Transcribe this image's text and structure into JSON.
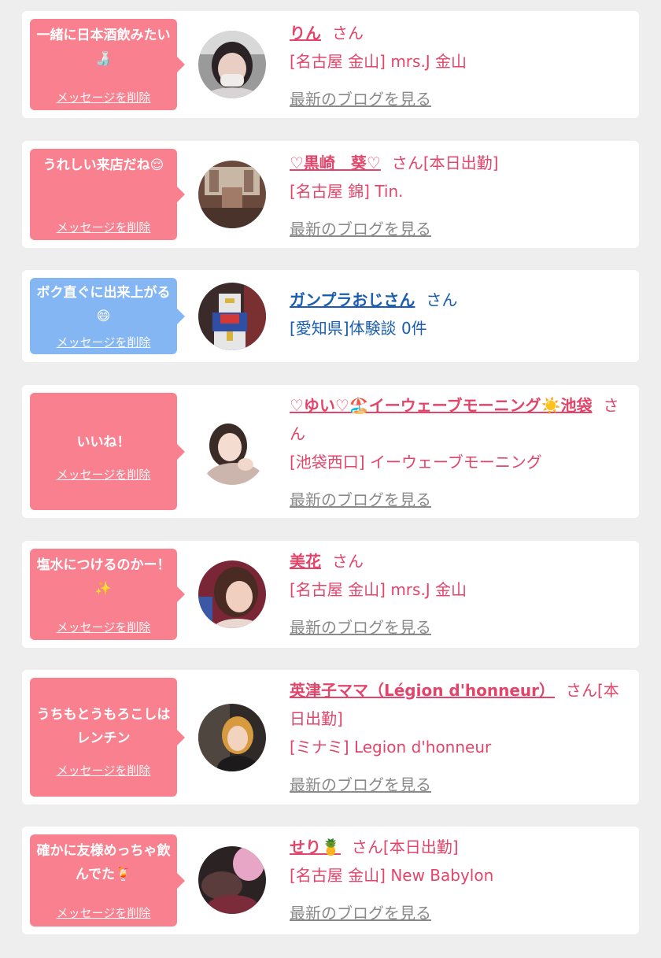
{
  "common": {
    "delete_label": "メッセージを削除",
    "blog_label": "最新のブログを見る",
    "honorific": "さん"
  },
  "colors": {
    "accent_pink": "#e2446a",
    "bubble_pink": "#f8808f",
    "bubble_blue": "#85b6f4",
    "link_blue": "#1a5db0",
    "muted": "#8a8a8a"
  },
  "cards": [
    {
      "message": "一緒に日本酒飲みたい🍶",
      "bubble_color": "pink",
      "name": "りん",
      "suffix": "さん",
      "shop": "[名古屋 金山] mrs.J 金山",
      "blog": "最新のブログを見る",
      "avatar": "avatar-photo-woman-mask"
    },
    {
      "message": "うれしい来店だね😌",
      "bubble_color": "pink",
      "name": "♡黒崎　葵♡",
      "suffix": "さん[本日出勤]",
      "shop": "[名古屋 錦] Tin.",
      "blog": "最新のブログを見る",
      "avatar": "avatar-photo-room"
    },
    {
      "message": "ボク直ぐに出来上がる😄",
      "bubble_color": "blue",
      "name": "ガンプラおじさん",
      "suffix": "さん",
      "shop": "[愛知県]体験談 0件",
      "blog": "",
      "avatar": "avatar-photo-gundam"
    },
    {
      "message": "いいね！",
      "bubble_color": "pink",
      "name": "♡ゆい♡🏖️イーウェーブモーニング☀️池袋",
      "suffix": "さん",
      "shop": "[池袋西口] イーウェーブモーニング",
      "blog": "最新のブログを見る",
      "avatar": "avatar-photo-woman-pose"
    },
    {
      "message": "塩水につけるのかー！✨",
      "bubble_color": "pink",
      "name": "美花",
      "suffix": "さん",
      "shop": "[名古屋 金山] mrs.J 金山",
      "blog": "最新のブログを見る",
      "avatar": "avatar-photo-woman-red"
    },
    {
      "message": "うちもとうもろこしはレンチン",
      "bubble_color": "pink",
      "name": "英津子ママ（Légion d'honneur）",
      "suffix": "さん[本日出勤]",
      "shop": "[ミナミ] Legion d'honneur",
      "blog": "最新のブログを見る",
      "avatar": "avatar-photo-woman-bar"
    },
    {
      "message": "確かに友様めっちゃ飲んでた🍹",
      "bubble_color": "pink",
      "name": "せり🍍",
      "suffix": "さん[本日出勤]",
      "shop": "[名古屋 金山] New Babylon",
      "blog": "最新のブログを見る",
      "avatar": "avatar-photo-dark"
    }
  ]
}
